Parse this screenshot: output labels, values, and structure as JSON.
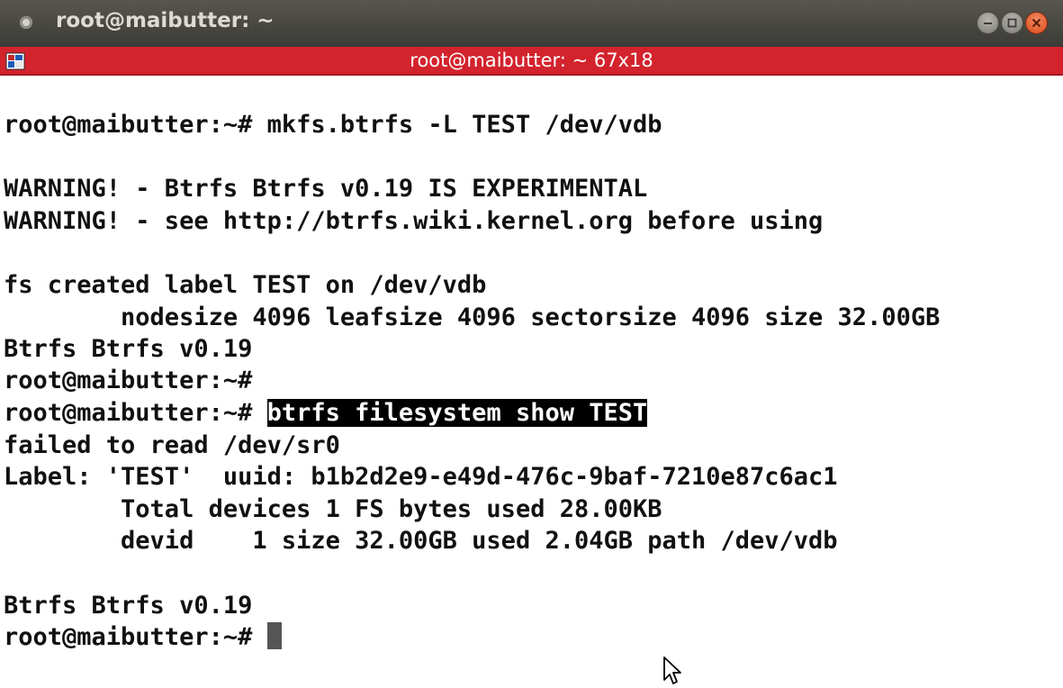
{
  "window": {
    "title": "root@maibutter: ~",
    "tab_title": "root@maibutter: ~ 67x18"
  },
  "terminal": {
    "lines": [
      "",
      "root@maibutter:~# mkfs.btrfs -L TEST /dev/vdb",
      "",
      "WARNING! - Btrfs Btrfs v0.19 IS EXPERIMENTAL",
      "WARNING! - see http://btrfs.wiki.kernel.org before using",
      "",
      "fs created label TEST on /dev/vdb",
      "        nodesize 4096 leafsize 4096 sectorsize 4096 size 32.00GB",
      "Btrfs Btrfs v0.19",
      "root@maibutter:~# ",
      "",
      "failed to read /dev/sr0",
      "Label: 'TEST'  uuid: b1b2d2e9-e49d-476c-9baf-7210e87c6ac1",
      "        Total devices 1 FS bytes used 28.00KB",
      "        devid    1 size 32.00GB used 2.04GB path /dev/vdb",
      "",
      "Btrfs Btrfs v0.19",
      ""
    ],
    "selected_prompt": "root@maibutter:~# ",
    "selected_command": "btrfs filesystem show TEST",
    "current_prompt": "root@maibutter:~# "
  },
  "icons": {
    "app_menu": "app-menu-icon",
    "minimize": "minimize-icon",
    "maximize": "maximize-icon",
    "close": "close-icon",
    "terminal_tab": "terminal-tab-icon",
    "pointer": "mouse-pointer-icon"
  },
  "colors": {
    "titlebar": "#3c3b37",
    "tabbar": "#d3232d",
    "close_button": "#e95420",
    "selection_bg": "#000000",
    "terminal_bg": "#ffffff"
  }
}
